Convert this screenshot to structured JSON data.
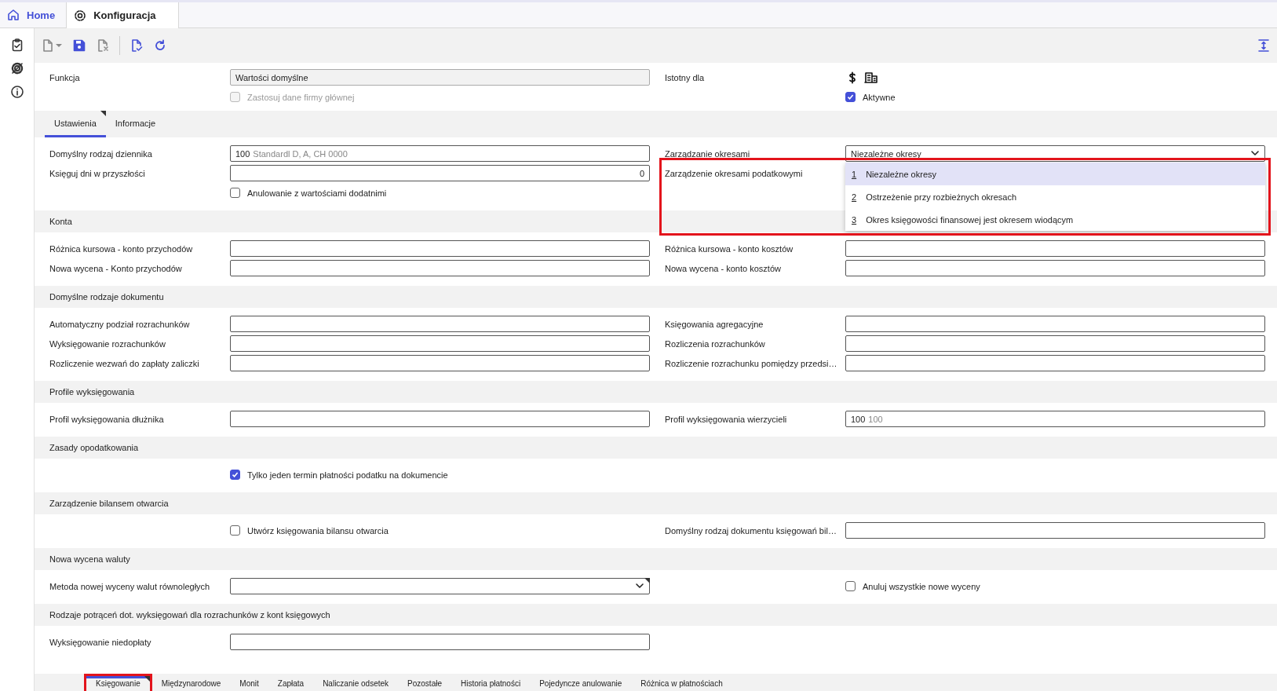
{
  "tabs": [
    {
      "label": "Home",
      "kind": "home",
      "selected": false
    },
    {
      "label": "Konfiguracja",
      "kind": "settings",
      "selected": true
    }
  ],
  "header": {
    "rows": [
      {
        "left": {
          "kind": "readonly",
          "label": "Funkcja",
          "value": "Wartości domyślne"
        },
        "right": {
          "kind": "icons",
          "label": "Istotny dla"
        }
      },
      {
        "left": {
          "kind": "checkbox",
          "label": "Zastosuj dane firmy głównej",
          "checked": false,
          "disabled": true
        },
        "right": {
          "kind": "checkbox",
          "label": "Aktywne",
          "checked": true,
          "disabled": false
        }
      }
    ]
  },
  "subtabs": [
    {
      "label": "Ustawienia",
      "selected": true,
      "corner_mark": true
    },
    {
      "label": "Informacje",
      "selected": false,
      "corner_mark": false
    }
  ],
  "sections": [
    {
      "rows": [
        {
          "left": {
            "kind": "field",
            "label": "Domyślny rodzaj dziennika",
            "value": "100",
            "hint": "Standardl D, A, CH 0000"
          },
          "right": {
            "kind": "select",
            "label": "Zarządzanie okresami",
            "value": "Niezależne okresy",
            "corner_mark": false
          }
        },
        {
          "left": {
            "kind": "number",
            "label": "Księguj dni w przyszłości",
            "value": "0"
          },
          "right": {
            "kind": "label",
            "label": "Zarządzenie okresami podatkowymi"
          }
        },
        {
          "left": {
            "kind": "checkbox",
            "label": "Anulowanie z wartościami dodatnimi",
            "checked": false,
            "disabled": false
          }
        }
      ]
    },
    {
      "title": "Konta",
      "rows": [
        {
          "left": {
            "kind": "field",
            "label": "Różnica kursowa - konto przychodów"
          },
          "right": {
            "kind": "field",
            "label": "Różnica kursowa - konto kosztów"
          }
        },
        {
          "left": {
            "kind": "field",
            "label": "Nowa wycena - Konto przychodów"
          },
          "right": {
            "kind": "field",
            "label": "Nowa wycena - konto kosztów"
          }
        }
      ]
    },
    {
      "title": "Domyślne rodzaje dokumentu",
      "rows": [
        {
          "left": {
            "kind": "field",
            "label": "Automatyczny podział rozrachunków"
          },
          "right": {
            "kind": "field",
            "label": "Księgowania agregacyjne"
          }
        },
        {
          "left": {
            "kind": "field",
            "label": "Wyksięgowanie rozrachunków"
          },
          "right": {
            "kind": "field",
            "label": "Rozliczenia rozrachunków"
          }
        },
        {
          "left": {
            "kind": "field",
            "label": "Rozliczenie wezwań do zapłaty zaliczki"
          },
          "right": {
            "kind": "field",
            "label": "Rozliczenie rozrachunku pomiędzy przedsi…"
          }
        }
      ]
    },
    {
      "title": "Profile wyksięgowania",
      "rows": [
        {
          "left": {
            "kind": "field",
            "label": "Profil wyksięgowania dłużnika"
          },
          "right": {
            "kind": "field",
            "label": "Profil wyksięgowania wierzycieli",
            "value": "100",
            "hint": "100"
          }
        }
      ]
    },
    {
      "title": "Zasady opodatkowania",
      "rows": [
        {
          "left": {
            "kind": "checkbox",
            "label": "Tylko jeden termin płatności podatku na dokumencie",
            "checked": true,
            "disabled": false
          }
        }
      ]
    },
    {
      "title": "Zarządzenie bilansem otwarcia",
      "rows": [
        {
          "left": {
            "kind": "checkbox",
            "label": "Utwórz księgowania bilansu otwarcia",
            "checked": false,
            "disabled": false
          },
          "right": {
            "kind": "field",
            "label": "Domyślny rodzaj dokumentu księgowań bil…"
          }
        }
      ]
    },
    {
      "title": "Nowa wycena waluty",
      "rows": [
        {
          "left": {
            "kind": "select",
            "label": "Metoda nowej wyceny walut równoległych",
            "corner_mark": true
          },
          "right": {
            "kind": "checkbox",
            "label": "Anuluj wszystkie nowe wyceny",
            "checked": false,
            "disabled": false
          }
        }
      ]
    },
    {
      "title": "Rodzaje potrąceń dot. wyksięgowań dla rozrachunków z kont księgowych",
      "rows": [
        {
          "left": {
            "kind": "field",
            "label": "Wyksięgowanie niedopłaty"
          }
        }
      ]
    }
  ],
  "dropdown": {
    "highlighted": true,
    "options": [
      {
        "key": "1",
        "label": "Niezależne okresy",
        "selected": true
      },
      {
        "key": "2",
        "label": "Ostrzeżenie przy rozbieżnych okresach",
        "selected": false
      },
      {
        "key": "3",
        "label": "Okres księgowości finansowej jest okresem wiodącym",
        "selected": false
      }
    ]
  },
  "bottom_tabs": [
    {
      "label": "Księgowanie",
      "selected": true,
      "corner_mark": true,
      "highlighted": true
    },
    {
      "label": "Międzynarodowe",
      "selected": false,
      "corner_mark": false,
      "highlighted": false
    },
    {
      "label": "Monit",
      "selected": false,
      "corner_mark": false,
      "highlighted": false
    },
    {
      "label": "Zapłata",
      "selected": false,
      "corner_mark": false,
      "highlighted": false
    },
    {
      "label": "Naliczanie odsetek",
      "selected": false,
      "corner_mark": false,
      "highlighted": false
    },
    {
      "label": "Pozostałe",
      "selected": false,
      "corner_mark": false,
      "highlighted": false
    },
    {
      "label": "Historia płatności",
      "selected": false,
      "corner_mark": false,
      "highlighted": false
    },
    {
      "label": "Pojedyncze anulowanie",
      "selected": false,
      "corner_mark": false,
      "highlighted": false
    },
    {
      "label": "Różnica w płatnościach",
      "selected": false,
      "corner_mark": false,
      "highlighted": false
    }
  ]
}
